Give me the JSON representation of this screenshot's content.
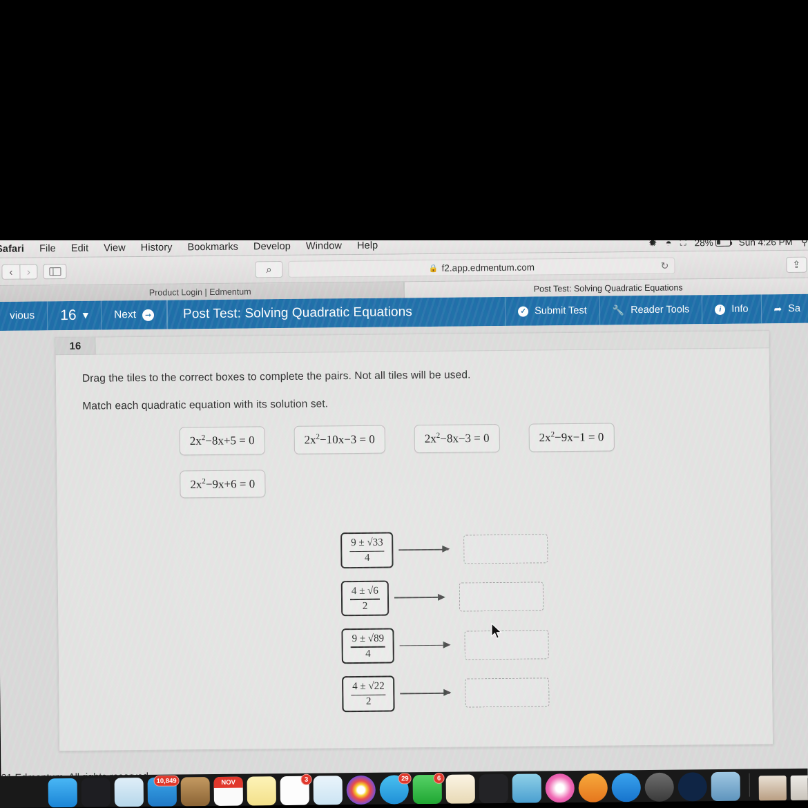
{
  "menubar": {
    "app": "Safari",
    "items": [
      "File",
      "Edit",
      "View",
      "History",
      "Bookmarks",
      "Develop",
      "Window",
      "Help"
    ],
    "bluetooth_icon": "bluetooth-icon",
    "wifi_icon": "wifi-icon",
    "airplay_icon": "airplay-icon",
    "battery_percent": "28%",
    "clock": "Sun 4:26 PM",
    "spotlight_icon": "search-icon"
  },
  "browser": {
    "back_icon": "‹",
    "forward_icon": "›",
    "sidebar_icon": "sidebar-icon",
    "search_icon": "⌕",
    "lock_icon": "🔒",
    "url": "f2.app.edmentum.com",
    "reload_icon": "↻",
    "share_icon": "⇧",
    "tabs": [
      {
        "label": "Product Login | Edmentum",
        "active": false
      },
      {
        "label": "Post Test: Solving Quadratic Equations",
        "active": true
      }
    ]
  },
  "appbar": {
    "previous_label": "vious",
    "question_number": "16",
    "chevron_icon": "⌄",
    "next_label": "Next",
    "next_icon": "➜",
    "title": "Post Test: Solving Quadratic Equations",
    "submit_label": "Submit Test",
    "submit_icon": "✓",
    "reader_tools_label": "Reader Tools",
    "reader_tools_icon": "🔧",
    "info_label": "Info",
    "info_icon": "i",
    "save_label": "Sa",
    "save_icon": "→]"
  },
  "question": {
    "number": "16",
    "instruction_1": "Drag the tiles to the correct boxes to complete the pairs. Not all tiles will be used.",
    "instruction_2": "Match each quadratic equation with its solution set.",
    "equation_tiles": [
      {
        "a": "2x",
        "sup": "2",
        "rest": "−8x+5 = 0",
        "text": "2x²−8x+5 = 0"
      },
      {
        "a": "2x",
        "sup": "2",
        "rest": "−10x−3 = 0",
        "text": "2x²−10x−3 = 0"
      },
      {
        "a": "2x",
        "sup": "2",
        "rest": "−8x−3 = 0",
        "text": "2x²−8x−3 = 0"
      },
      {
        "a": "2x",
        "sup": "2",
        "rest": "−9x−1 = 0",
        "text": "2x²−9x−1 = 0"
      },
      {
        "a": "2x",
        "sup": "2",
        "rest": "−9x+6 = 0",
        "text": "2x²−9x+6 = 0"
      }
    ],
    "match_rows": [
      {
        "numerator": "9 ± √33",
        "denominator": "4",
        "drop_value": ""
      },
      {
        "numerator": "4 ± √6",
        "denominator": "2",
        "drop_value": ""
      },
      {
        "numerator": "9 ± √89",
        "denominator": "4",
        "drop_value": ""
      },
      {
        "numerator": "4 ± √22",
        "denominator": "2",
        "drop_value": ""
      }
    ]
  },
  "footer": {
    "copyright": "21 Edmentum. All rights reserved."
  },
  "dock": {
    "badges": {
      "mail": "10,849",
      "calendar": "NOV",
      "notes": "3",
      "messages": "29",
      "facetime": "6"
    }
  },
  "colors": {
    "brand_blue": "#1a6ca8",
    "page_bg": "#d9d9d9",
    "card_bg": "#e3e3e2",
    "badge_red": "#e0382c"
  }
}
